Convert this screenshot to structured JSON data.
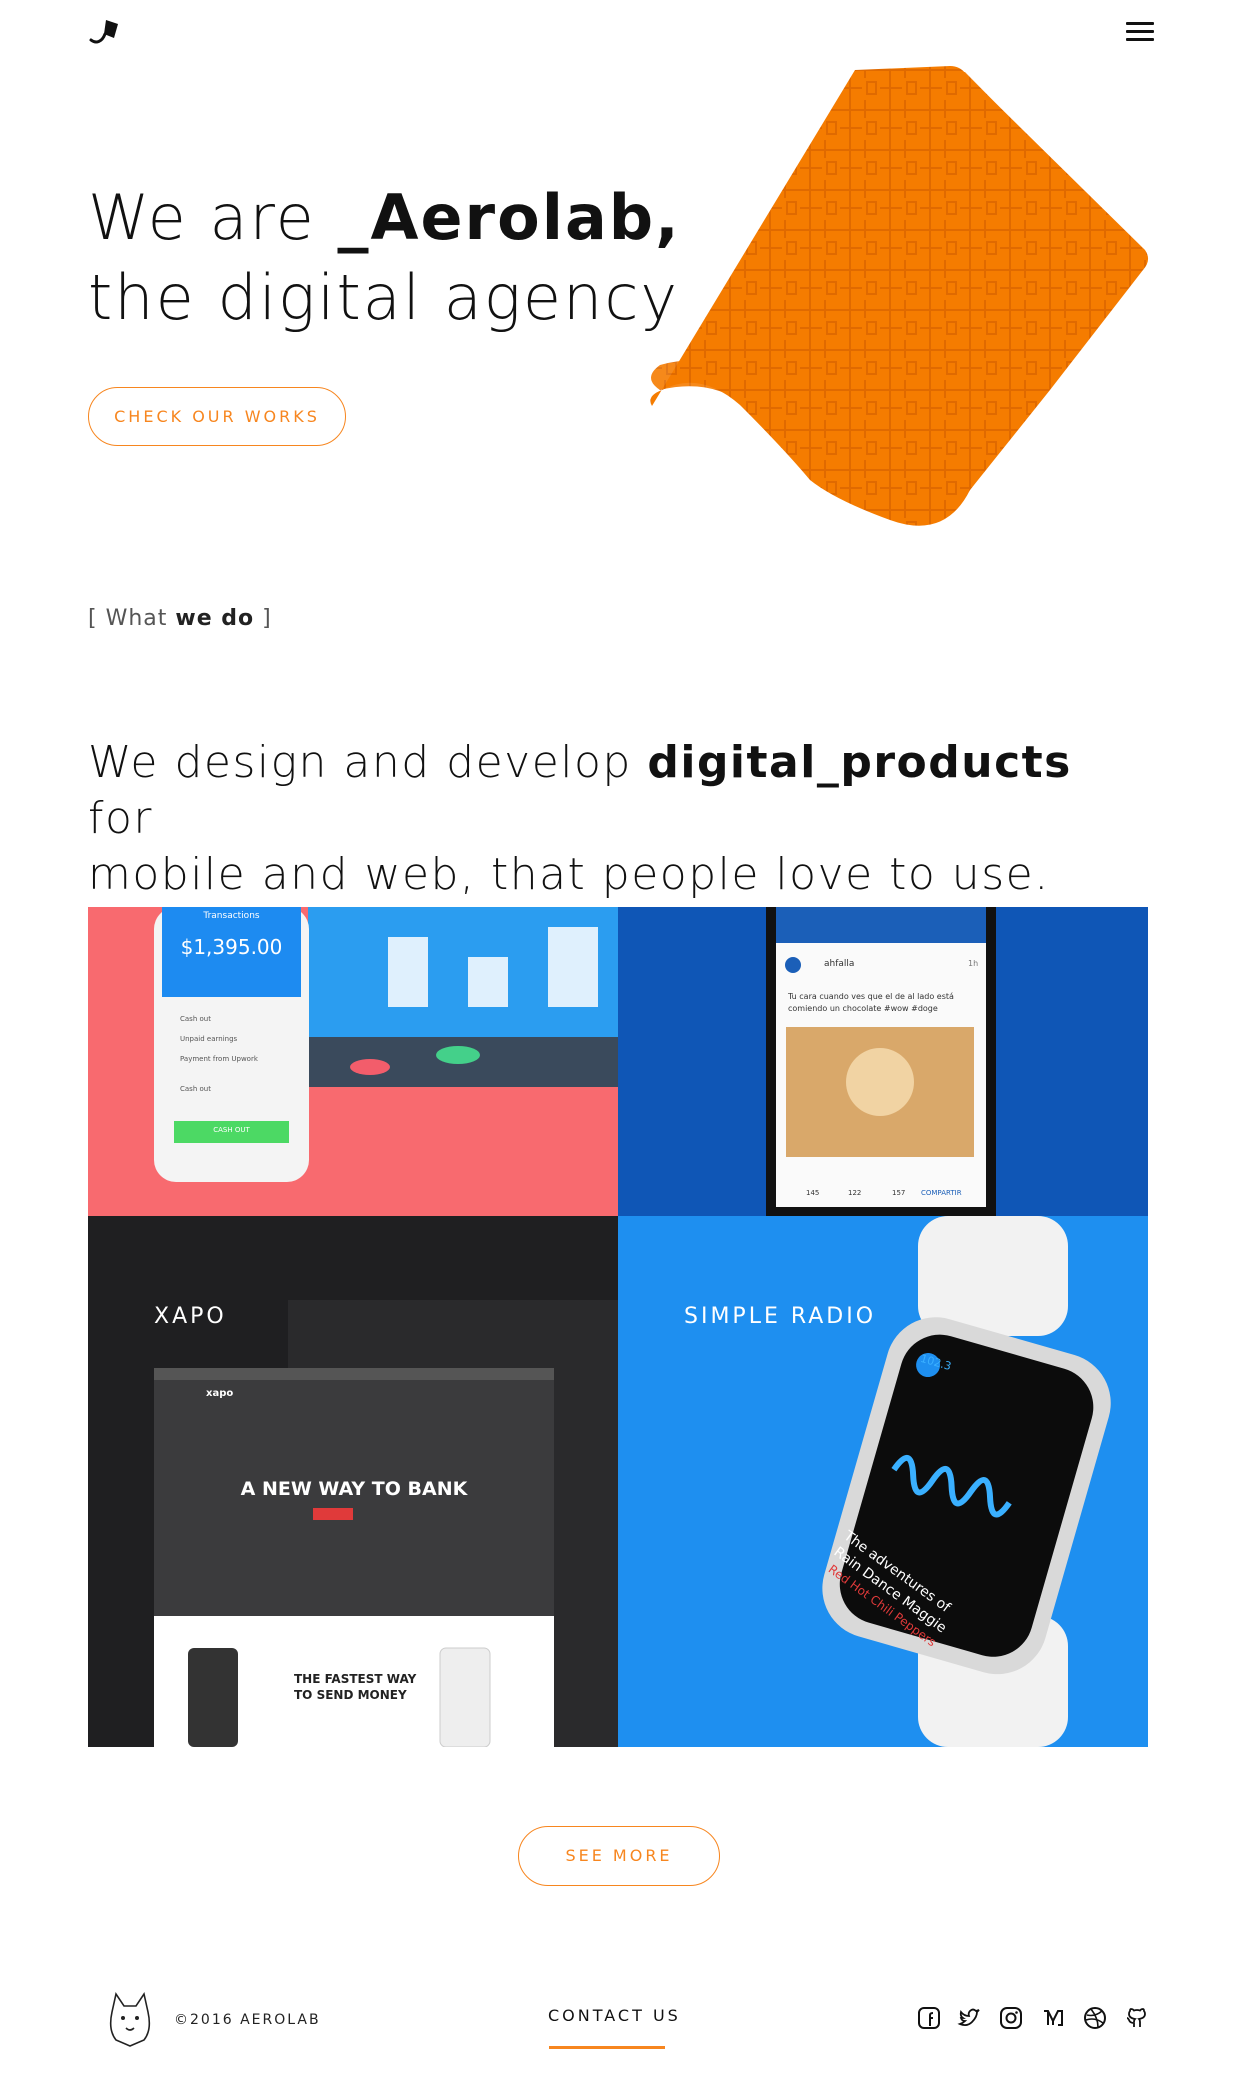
{
  "header": {
    "logo_icon": "kite-logo-icon",
    "menu_icon": "hamburger-menu-icon"
  },
  "hero": {
    "line1_prefix": "We are ",
    "line1_brand": "_Aerolab,",
    "line2": "the digital agency",
    "cta_label": "CHECK OUR WORKS"
  },
  "what_we_do": {
    "open": "[ What ",
    "bold": "we do",
    "close": " ]"
  },
  "statement": {
    "part1": "We design and develop ",
    "bold": "digital_products",
    "part2": " for",
    "line2": "mobile and web, that people love to use."
  },
  "works": {
    "tile1": {
      "balance": "$1,395.00",
      "header": "Transactions",
      "button": "CASH OUT",
      "rows": [
        "Cash out",
        "Unpaid earnings",
        "Payment from Upwork",
        "Cash out"
      ]
    },
    "tile2": {
      "user": "ahfalla",
      "time": "1h",
      "post": "Tu cara cuando ves que el de al lado está comiendo un chocolate #wow #doge",
      "stats": [
        "145",
        "122",
        "157"
      ],
      "share": "COMPARTIR"
    },
    "tile3": {
      "label": "XAPO",
      "brand": "xapo",
      "headline": "A NEW WAY TO BANK",
      "sub_headline_1": "THE FASTEST WAY",
      "sub_headline_2": "TO SEND MONEY"
    },
    "tile4": {
      "label": "SIMPLE RADIO",
      "station": "102.3",
      "song_1": "The adventures of",
      "song_2": "Rain Dance Maggie",
      "artist": "Red Hot Chili Peppers"
    }
  },
  "see_more_label": "SEE MORE",
  "footer": {
    "copyright": "©2016 AEROLAB",
    "contact_label": "CONTACT US",
    "social_icons": [
      "facebook-icon",
      "twitter-icon",
      "instagram-icon",
      "medium-icon",
      "dribbble-icon",
      "github-icon"
    ]
  },
  "colors": {
    "accent": "#f7861f",
    "coral": "#f86a6f",
    "navy": "#0f56b6",
    "dark": "#1f1f21",
    "sky": "#1e8ff0"
  }
}
